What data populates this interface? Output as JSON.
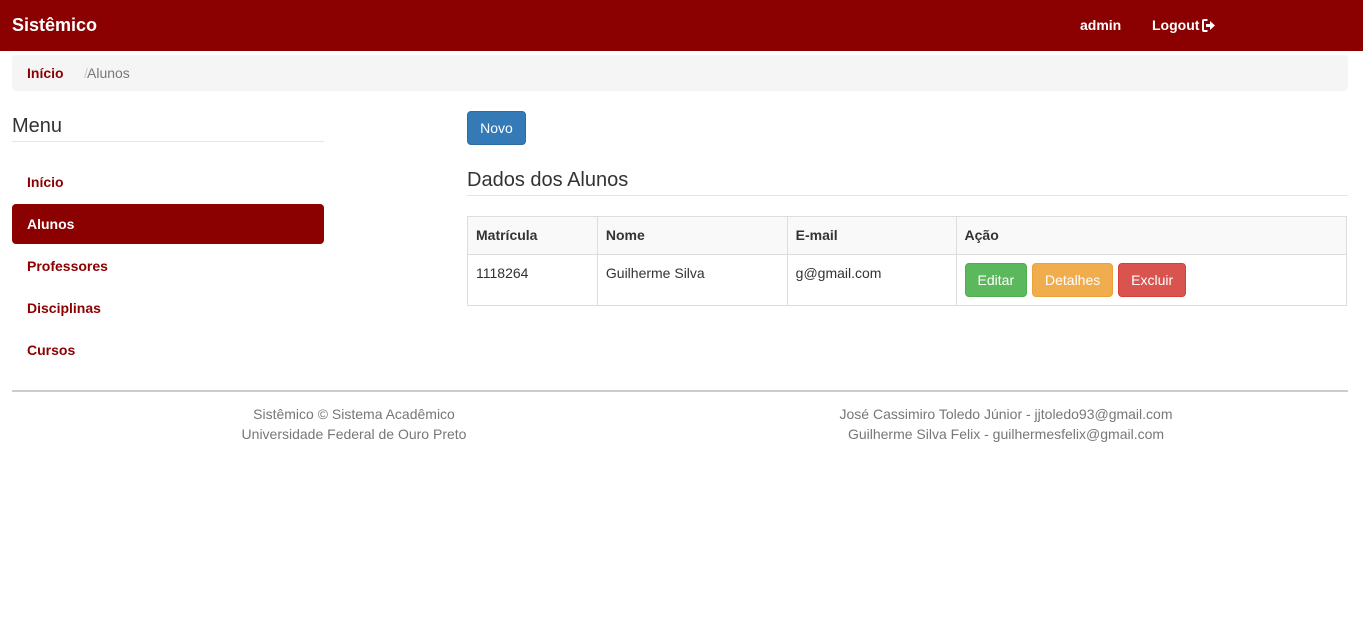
{
  "navbar": {
    "brand": "Sistêmico",
    "user": "admin",
    "logout_label": "Logout"
  },
  "breadcrumb": {
    "home": "Início",
    "separator": "/",
    "current": "Alunos"
  },
  "menu": {
    "title": "Menu",
    "items": [
      {
        "label": "Início"
      },
      {
        "label": "Alunos"
      },
      {
        "label": "Professores"
      },
      {
        "label": "Disciplinas"
      },
      {
        "label": "Cursos"
      }
    ]
  },
  "main": {
    "new_button": "Novo",
    "title": "Dados dos Alunos",
    "table": {
      "headers": [
        "Matrícula",
        "Nome",
        "E-mail",
        "Ação"
      ],
      "rows": [
        {
          "matricula": "1118264",
          "nome": "Guilherme Silva",
          "email": "g@gmail.com"
        }
      ],
      "actions": {
        "edit": "Editar",
        "details": "Detalhes",
        "delete": "Excluir"
      }
    }
  },
  "footer": {
    "left": [
      "Sistêmico © Sistema Acadêmico",
      "Universidade Federal de Ouro Preto"
    ],
    "right": [
      "José Cassimiro Toledo Júnior - jjtoledo93@gmail.com",
      "Guilherme Silva Felix - guilhermesfelix@gmail.com"
    ]
  },
  "colors": {
    "brand": "#8b0000",
    "primary": "#337ab7",
    "success": "#5cb85c",
    "warning": "#f0ad4e",
    "danger": "#d9534f"
  },
  "icons": {
    "logout": "sign-out-icon"
  }
}
